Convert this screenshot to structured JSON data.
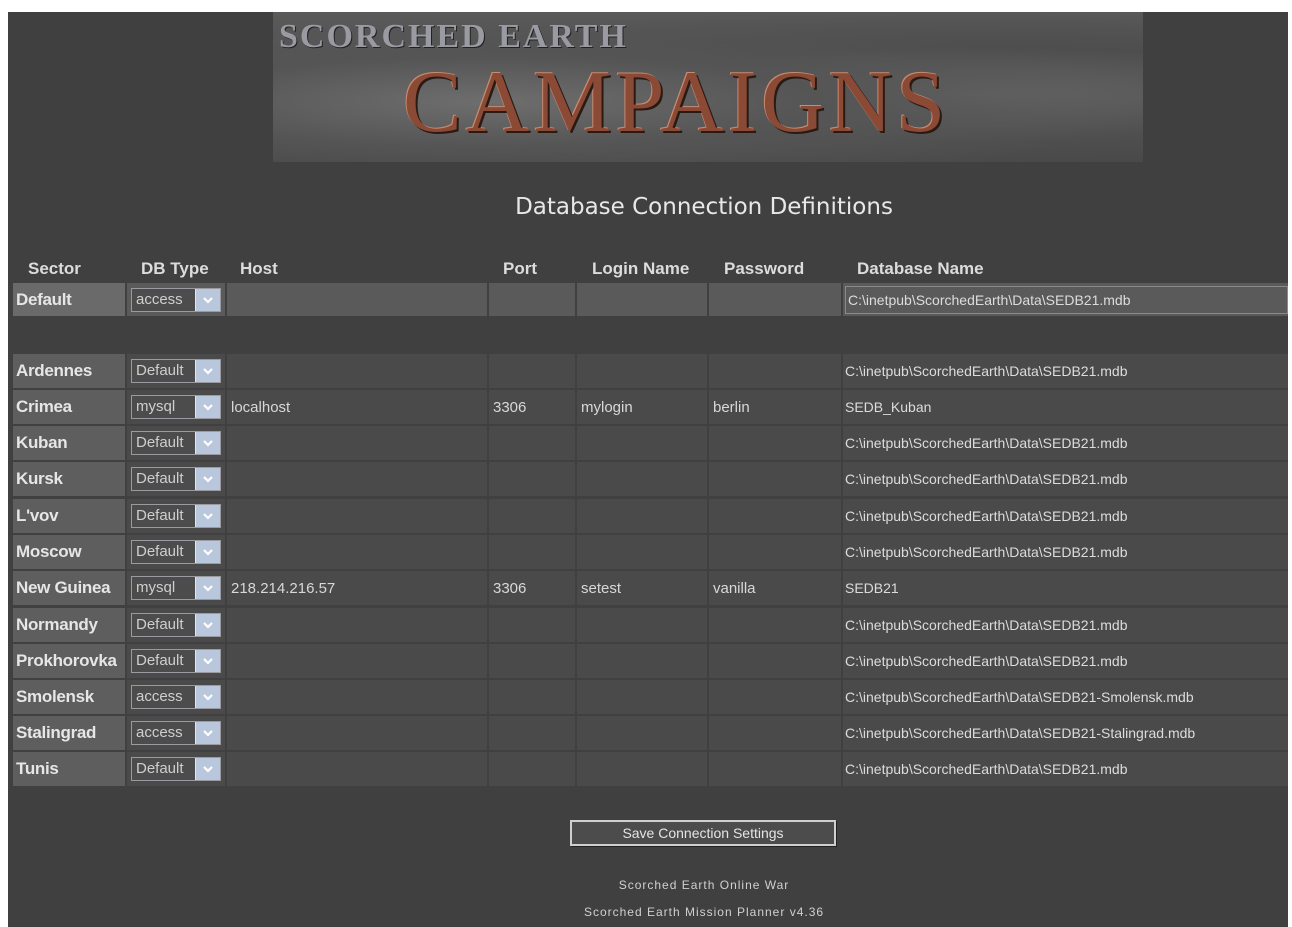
{
  "header": {
    "logo_top": "SCORCHED EARTH",
    "logo_main": "CAMPAIGNS",
    "title": "Database Connection Definitions"
  },
  "columns": {
    "sector": "Sector",
    "db_type": "DB Type",
    "host": "Host",
    "port": "Port",
    "login": "Login Name",
    "password": "Password",
    "database": "Database Name"
  },
  "rows": [
    {
      "sector": "Default",
      "type": "access",
      "host": "",
      "port": "",
      "login": "",
      "password": "",
      "database": "C:\\inetpub\\ScorchedEarth\\Data\\SEDB21.mdb"
    },
    {
      "sector": "Ardennes",
      "type": "Default",
      "host": "",
      "port": "",
      "login": "",
      "password": "",
      "database": "C:\\inetpub\\ScorchedEarth\\Data\\SEDB21.mdb"
    },
    {
      "sector": "Crimea",
      "type": "mysql",
      "host": "localhost",
      "port": "3306",
      "login": "mylogin",
      "password": "berlin",
      "database": "SEDB_Kuban"
    },
    {
      "sector": "Kuban",
      "type": "Default",
      "host": "",
      "port": "",
      "login": "",
      "password": "",
      "database": "C:\\inetpub\\ScorchedEarth\\Data\\SEDB21.mdb"
    },
    {
      "sector": "Kursk",
      "type": "Default",
      "host": "",
      "port": "",
      "login": "",
      "password": "",
      "database": "C:\\inetpub\\ScorchedEarth\\Data\\SEDB21.mdb"
    },
    {
      "sector": "L'vov",
      "type": "Default",
      "host": "",
      "port": "",
      "login": "",
      "password": "",
      "database": "C:\\inetpub\\ScorchedEarth\\Data\\SEDB21.mdb"
    },
    {
      "sector": "Moscow",
      "type": "Default",
      "host": "",
      "port": "",
      "login": "",
      "password": "",
      "database": "C:\\inetpub\\ScorchedEarth\\Data\\SEDB21.mdb"
    },
    {
      "sector": "New Guinea",
      "type": "mysql",
      "host": "218.214.216.57",
      "port": "3306",
      "login": "setest",
      "password": "vanilla",
      "database": "SEDB21"
    },
    {
      "sector": "Normandy",
      "type": "Default",
      "host": "",
      "port": "",
      "login": "",
      "password": "",
      "database": "C:\\inetpub\\ScorchedEarth\\Data\\SEDB21.mdb"
    },
    {
      "sector": "Prokhorovka",
      "type": "Default",
      "host": "",
      "port": "",
      "login": "",
      "password": "",
      "database": "C:\\inetpub\\ScorchedEarth\\Data\\SEDB21.mdb"
    },
    {
      "sector": "Smolensk",
      "type": "access",
      "host": "",
      "port": "",
      "login": "",
      "password": "",
      "database": "C:\\inetpub\\ScorchedEarth\\Data\\SEDB21-Smolensk.mdb"
    },
    {
      "sector": "Stalingrad",
      "type": "access",
      "host": "",
      "port": "",
      "login": "",
      "password": "",
      "database": "C:\\inetpub\\ScorchedEarth\\Data\\SEDB21-Stalingrad.mdb"
    },
    {
      "sector": "Tunis",
      "type": "Default",
      "host": "",
      "port": "",
      "login": "",
      "password": "",
      "database": "C:\\inetpub\\ScorchedEarth\\Data\\SEDB21.mdb"
    }
  ],
  "save_button": "Save Connection Settings",
  "footer": {
    "line1": "Scorched Earth Online War",
    "line2": "Scorched Earth Mission Planner v4.36"
  },
  "icons": {
    "dropdown": "chevron-down-icon"
  }
}
